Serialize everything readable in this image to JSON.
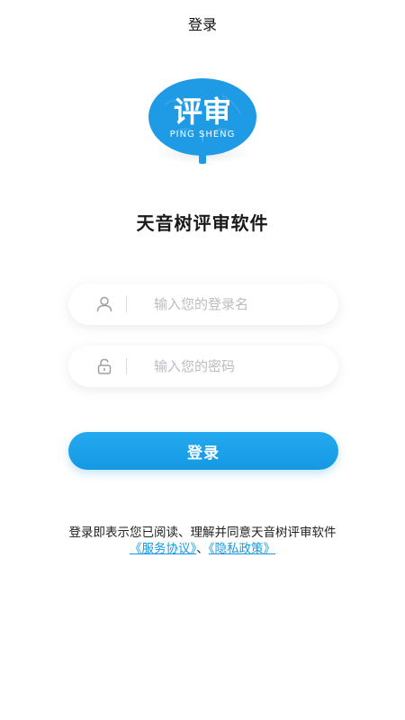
{
  "header": {
    "title": "登录"
  },
  "logo": {
    "text": "评审",
    "subtext": "PING SHENG",
    "color": "#1f9be6"
  },
  "app": {
    "name": "天音树评审软件"
  },
  "form": {
    "username_placeholder": "输入您的登录名",
    "password_placeholder": "输入您的密码",
    "username_icon": "user-icon",
    "password_icon": "lock-icon"
  },
  "login_button": {
    "label": "登录",
    "color": "#1598e3"
  },
  "agreement": {
    "text": "登录即表示您已阅读、理解并同意天音树评审软件",
    "service_link": "《服务协议》",
    "separator": "、",
    "privacy_link": "《隐私政策》",
    "link_color": "#1598e3"
  }
}
